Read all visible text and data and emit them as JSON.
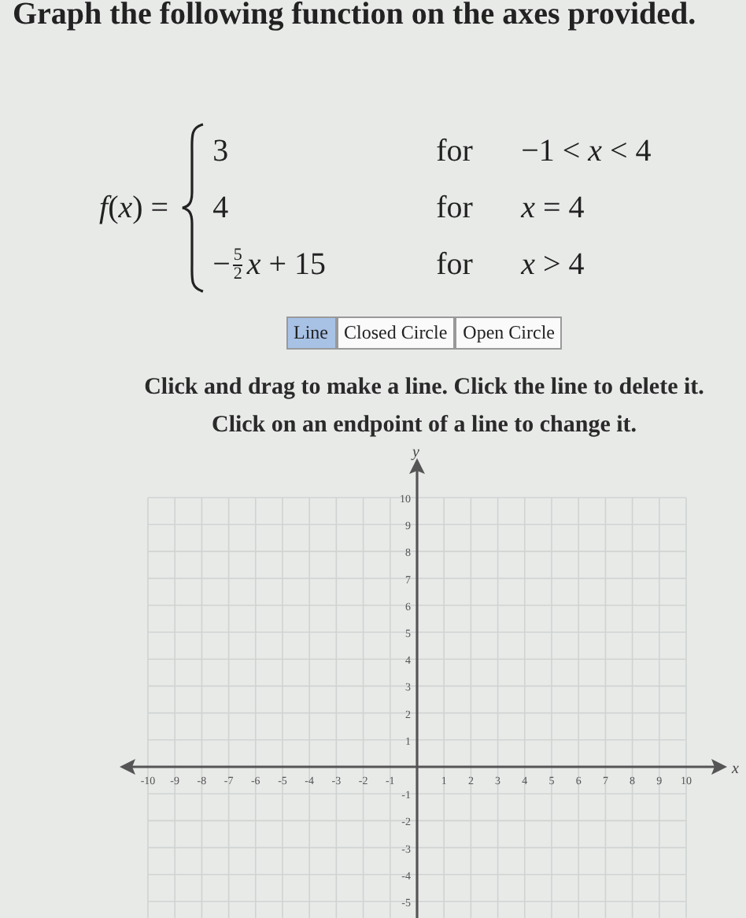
{
  "title": "Graph the following function on the axes provided.",
  "function": {
    "name": "*f*(*x*) =",
    "cases": [
      {
        "kind": "plain",
        "expression": "3",
        "for": "for",
        "condition": "−1 < *x* < 4"
      },
      {
        "kind": "plain",
        "expression": "4",
        "for": "for",
        "condition": "*x* = 4"
      },
      {
        "kind": "fraction",
        "sign": "−",
        "numerator": "5",
        "denominator": "2",
        "expression": "*x* + 15",
        "for": "for",
        "condition": "*x* > 4"
      }
    ]
  },
  "tools": [
    {
      "label": "Line",
      "selected": true
    },
    {
      "label": "Closed Circle",
      "selected": false
    },
    {
      "label": "Open Circle",
      "selected": false
    }
  ],
  "instructions": [
    "Click and drag to make a line. Click the line to delete it.",
    "Click on an endpoint of a line to change it."
  ],
  "graph": {
    "chart_data": {
      "type": "line",
      "grid": true,
      "xlabel": "x",
      "ylabel": "y",
      "xlim": [
        -10,
        10
      ],
      "ylim": [
        -5,
        10
      ],
      "xticks": [
        -10,
        -9,
        -8,
        -7,
        -6,
        -5,
        -4,
        -3,
        -2,
        -1,
        1,
        2,
        3,
        4,
        5,
        6,
        7,
        8,
        9,
        10
      ],
      "yticks": [
        -5,
        -4,
        -3,
        -2,
        -1,
        1,
        2,
        3,
        4,
        5,
        6,
        7,
        8,
        9,
        10
      ]
    }
  }
}
